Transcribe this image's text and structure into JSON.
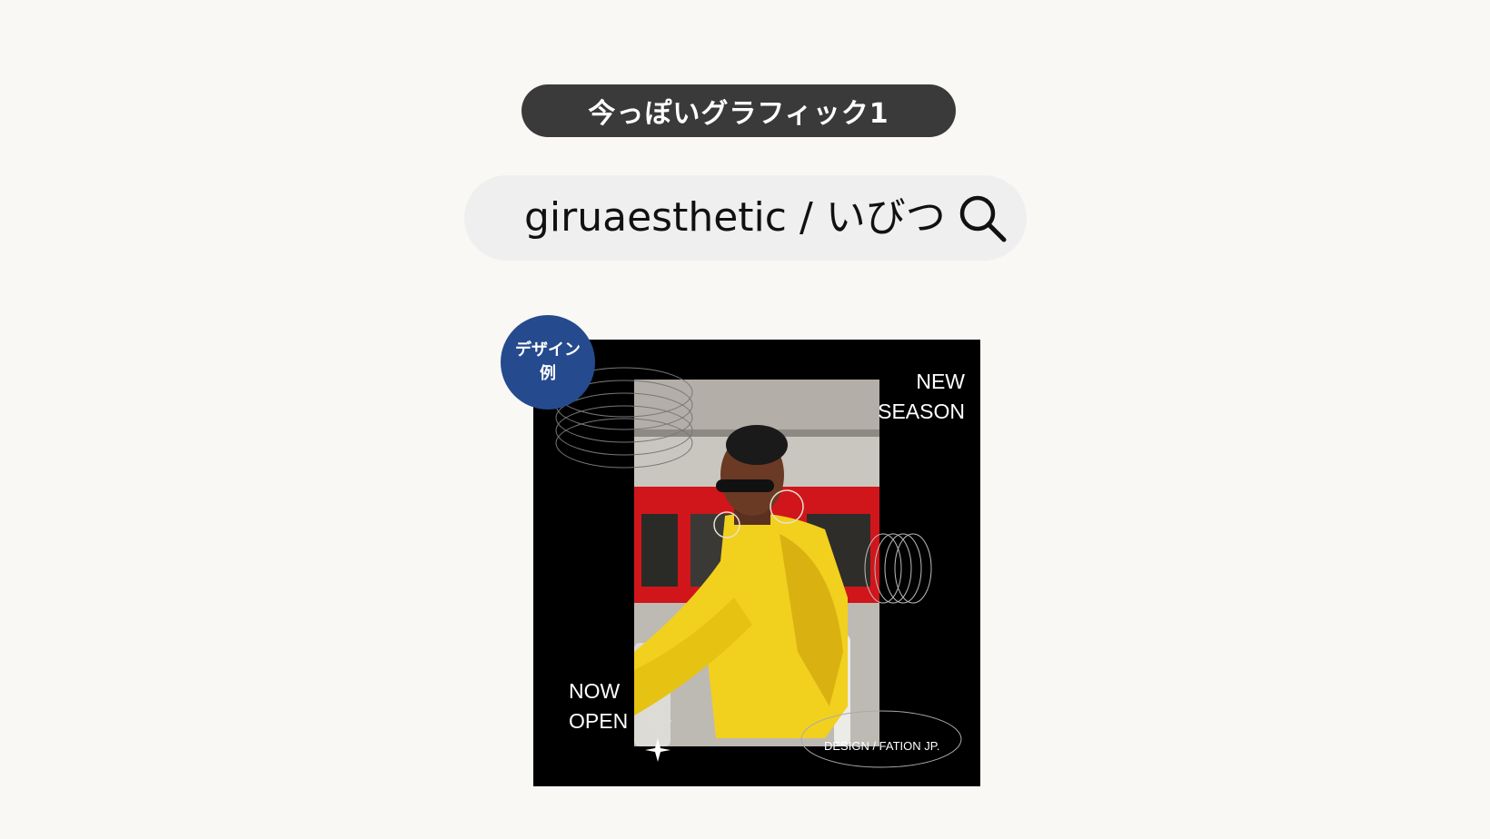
{
  "header": {
    "title": "今っぽいグラフィック1"
  },
  "search": {
    "query": "giruaesthetic / いびつ",
    "icon": "search-icon"
  },
  "badge": {
    "line1": "デザイン",
    "line2": "例",
    "color": "#254a8d"
  },
  "card": {
    "top_right_line1": "NEW",
    "top_right_line2": "SEASON",
    "bottom_left_line1": "NOW",
    "bottom_left_line2": "OPEN",
    "credit": "DESIGN / FATION JP.",
    "icons": [
      "sparkle-icon",
      "ring-graphic"
    ]
  },
  "colors": {
    "background": "#f9f8f5",
    "pill": "#3a3a3a",
    "search_bar": "#efefef",
    "card": "#000000",
    "jacket_yellow": "#f2d01e",
    "window_red": "#d0161b"
  }
}
